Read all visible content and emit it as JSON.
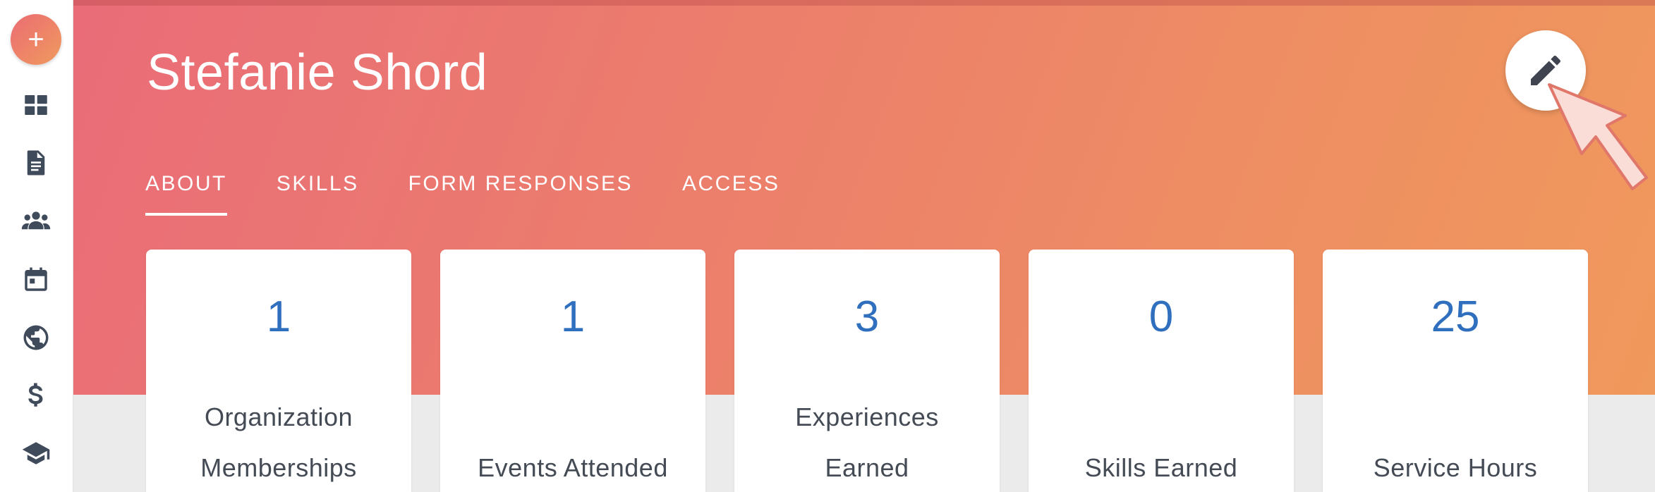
{
  "sidebar": {
    "add_label": "+",
    "items": [
      {
        "icon": "dashboard-icon"
      },
      {
        "icon": "document-icon"
      },
      {
        "icon": "people-icon"
      },
      {
        "icon": "calendar-icon"
      },
      {
        "icon": "globe-icon"
      },
      {
        "icon": "dollar-icon"
      },
      {
        "icon": "graduation-cap-icon"
      }
    ]
  },
  "header": {
    "name": "Stefanie Shord",
    "edit_icon": "pencil-icon"
  },
  "tabs": [
    {
      "label": "ABOUT",
      "active": true
    },
    {
      "label": "SKILLS",
      "active": false
    },
    {
      "label": "FORM RESPONSES",
      "active": false
    },
    {
      "label": "ACCESS",
      "active": false
    }
  ],
  "stats": [
    {
      "value": "1",
      "label_line1": "Organization",
      "label_line2": "Memberships"
    },
    {
      "value": "1",
      "label_line1": "",
      "label_line2": "Events Attended"
    },
    {
      "value": "3",
      "label_line1": "Experiences",
      "label_line2": "Earned"
    },
    {
      "value": "0",
      "label_line1": "",
      "label_line2": "Skills Earned"
    },
    {
      "value": "25",
      "label_line1": "",
      "label_line2": "Service Hours"
    }
  ],
  "colors": {
    "gradient_start": "#e96c78",
    "gradient_end": "#f0995c",
    "stat_value": "#2f6fbe",
    "icon": "#3f4a5a"
  }
}
